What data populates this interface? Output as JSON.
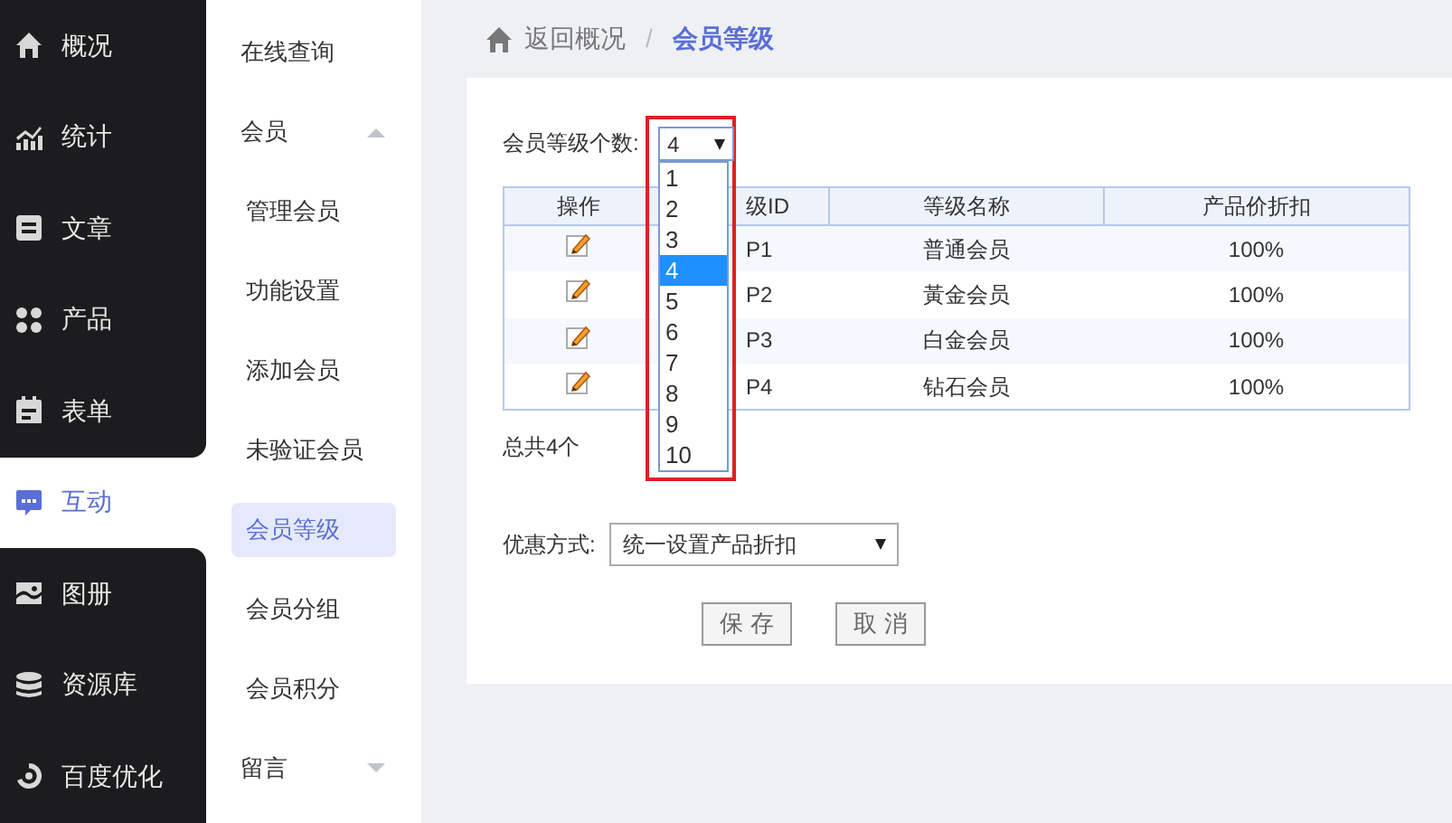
{
  "sidebar": {
    "items": [
      {
        "label": "概况",
        "selected": false
      },
      {
        "label": "统计",
        "selected": false
      },
      {
        "label": "文章",
        "selected": false
      },
      {
        "label": "产品",
        "selected": false
      },
      {
        "label": "表单",
        "selected": false
      },
      {
        "label": "互动",
        "selected": true
      },
      {
        "label": "图册",
        "selected": false
      },
      {
        "label": "资源库",
        "selected": false
      },
      {
        "label": "百度优化",
        "selected": false
      }
    ]
  },
  "submenu": {
    "items": [
      {
        "label": "在线查询",
        "kind": "link",
        "selected": false
      },
      {
        "label": "会员",
        "kind": "group",
        "expanded": true,
        "children": [
          {
            "label": "管理会员",
            "selected": false
          },
          {
            "label": "功能设置",
            "selected": false
          },
          {
            "label": "添加会员",
            "selected": false
          },
          {
            "label": "未验证会员",
            "selected": false
          },
          {
            "label": "会员等级",
            "selected": true
          },
          {
            "label": "会员分组",
            "selected": false
          },
          {
            "label": "会员积分",
            "selected": false
          }
        ]
      },
      {
        "label": "留言",
        "kind": "group",
        "expanded": false
      }
    ]
  },
  "breadcrumb": {
    "back": "返回概况",
    "separator": "/",
    "current": "会员等级"
  },
  "level_count": {
    "label": "会员等级个数:",
    "value": "4",
    "options": [
      {
        "label": "1",
        "selected": false
      },
      {
        "label": "2",
        "selected": false
      },
      {
        "label": "3",
        "selected": false
      },
      {
        "label": "4",
        "selected": true
      },
      {
        "label": "5",
        "selected": false
      },
      {
        "label": "6",
        "selected": false
      },
      {
        "label": "7",
        "selected": false
      },
      {
        "label": "8",
        "selected": false
      },
      {
        "label": "9",
        "selected": false
      },
      {
        "label": "10",
        "selected": false
      }
    ]
  },
  "table": {
    "columns": [
      "操作",
      "级ID",
      "等级名称",
      "产品价折扣"
    ],
    "rows": [
      {
        "id": "P1",
        "name": "普通会员",
        "discount": "100%"
      },
      {
        "id": "P2",
        "name": "黃金会员",
        "discount": "100%"
      },
      {
        "id": "P3",
        "name": "白金会员",
        "discount": "100%"
      },
      {
        "id": "P4",
        "name": "钻石会员",
        "discount": "100%"
      }
    ]
  },
  "total": "总共4个",
  "discount_mode": {
    "label": "优惠方式:",
    "value": "统一设置产品折扣"
  },
  "buttons": [
    "保 存",
    "取 消"
  ]
}
